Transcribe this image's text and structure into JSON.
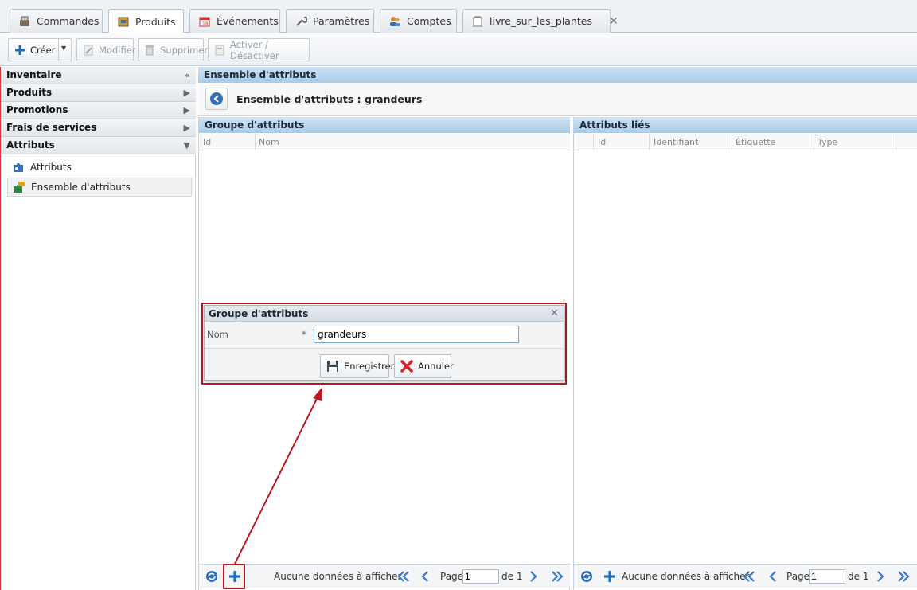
{
  "tabs": [
    {
      "label": "Commandes",
      "icon": "register-icon"
    },
    {
      "label": "Produits",
      "icon": "box-icon",
      "active": true
    },
    {
      "label": "Événements",
      "icon": "calendar-icon"
    },
    {
      "label": "Paramètres",
      "icon": "wrench-icon"
    },
    {
      "label": "Comptes",
      "icon": "users-icon"
    },
    {
      "label": "livre_sur_les_plantes",
      "icon": "document-icon",
      "closable": true
    }
  ],
  "toolbar": {
    "create_label": "Créer",
    "modify_label": "Modifier",
    "delete_label": "Supprimer",
    "toggle_label": "Activer / Désactiver"
  },
  "sidebar": {
    "sections": [
      {
        "label": "Inventaire",
        "arrow": "«"
      },
      {
        "label": "Produits",
        "arrow": "▶"
      },
      {
        "label": "Promotions",
        "arrow": "▶"
      },
      {
        "label": "Frais de services",
        "arrow": "▶"
      },
      {
        "label": "Attributs",
        "arrow": "▼"
      }
    ],
    "items": [
      {
        "label": "Attributs",
        "icon": "puzzle-icon"
      },
      {
        "label": "Ensemble d'attributs",
        "icon": "puzzle-set-icon",
        "selected": true
      }
    ]
  },
  "main": {
    "header": "Ensemble d'attributs",
    "subtitle": "Ensemble d'attributs : grandeurs",
    "left_panel": {
      "title": "Groupe d'attributs",
      "columns": [
        "Id",
        "Nom"
      ],
      "empty_text": "Aucune données à afficher",
      "page_label": "Page",
      "page_value": "1",
      "of_label": "de 1"
    },
    "right_panel": {
      "title": "Attributs liés",
      "columns": [
        "Id",
        "Identifiant",
        "Étiquette",
        "Type"
      ],
      "empty_text": "Aucune données à afficher",
      "page_label": "Page",
      "page_value": "1",
      "of_label": "de 1"
    }
  },
  "dialog": {
    "title": "Groupe d'attributs",
    "field_label": "Nom",
    "required_mark": "*",
    "field_value": "grandeurs",
    "save_label": "Enregistrer",
    "cancel_label": "Annuler"
  },
  "colors": {
    "annotation": "#c0191f",
    "header_blue": "#a9cbe7",
    "accent_blue": "#1f6fc0"
  }
}
